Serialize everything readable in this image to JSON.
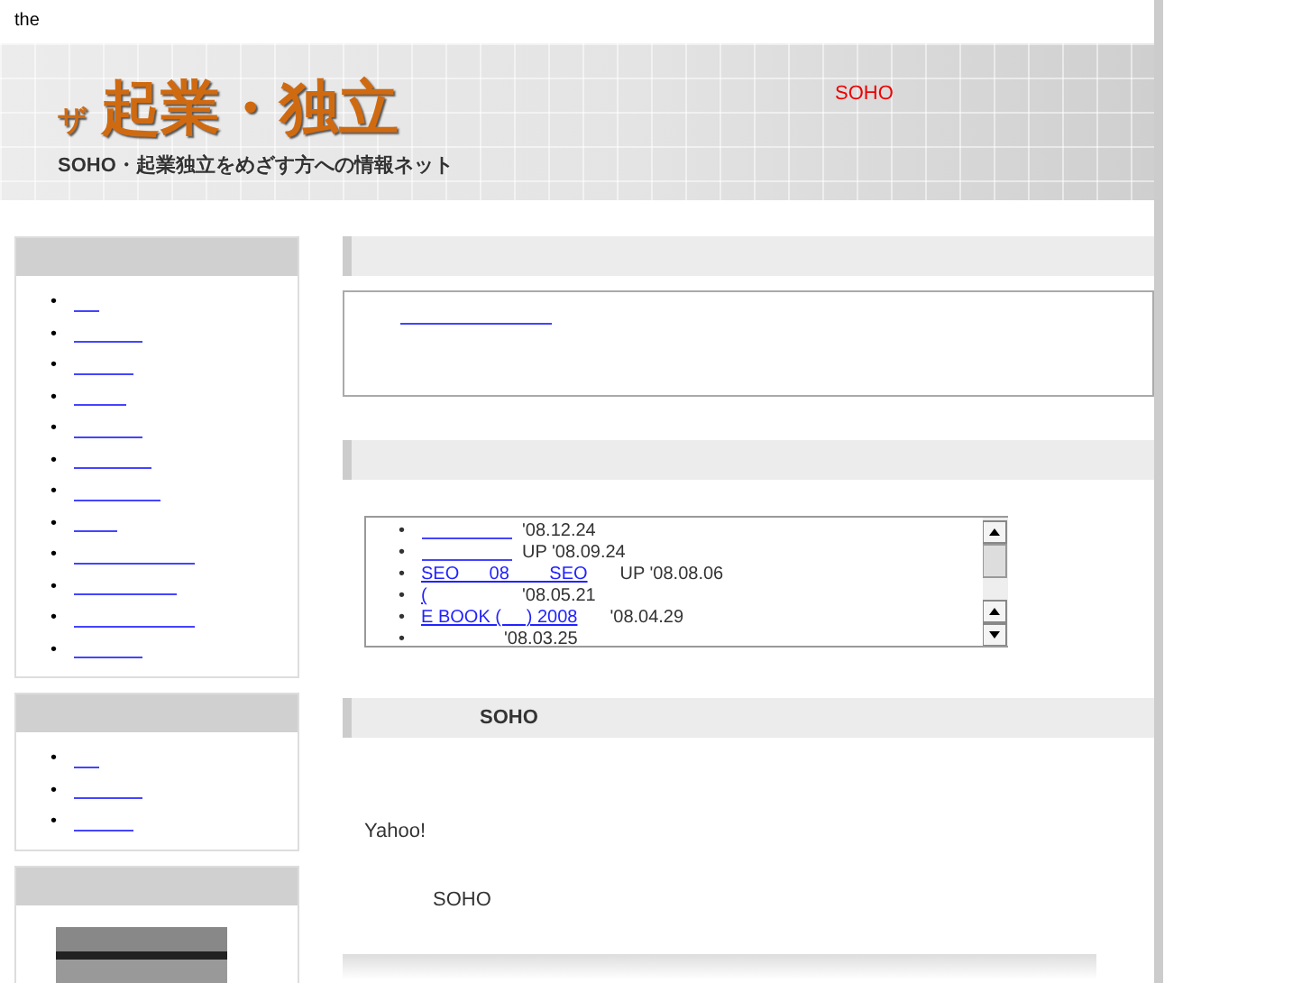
{
  "top_text": "the",
  "banner": {
    "logo_mark": "ザ",
    "logo_title": "起業・独立",
    "logo_tagline": "SOHO・起業独立をめざす方への情報ネット",
    "note": "SOHO"
  },
  "sidebar": [
    {
      "kind": "links",
      "links": [
        {
          "kind": "blank",
          "marker": "•"
        },
        {
          "kind": "blank",
          "marker": "•"
        },
        {
          "kind": "blank",
          "marker": "•"
        },
        {
          "kind": "blank",
          "marker": "•"
        },
        {
          "kind": "blank",
          "marker": "•"
        },
        {
          "kind": "blank",
          "marker": "•"
        },
        {
          "kind": "blank",
          "marker": "•"
        },
        {
          "kind": "blank",
          "marker": "•"
        },
        {
          "kind": "blank",
          "marker": "•"
        },
        {
          "kind": "blank",
          "marker": "•"
        },
        {
          "kind": "blank",
          "marker": "•"
        },
        {
          "kind": "blank",
          "marker": "•"
        }
      ]
    },
    {
      "kind": "links",
      "links": [
        {
          "kind": "blank",
          "marker": "•"
        },
        {
          "kind": "blank",
          "marker": "•"
        },
        {
          "kind": "blank",
          "marker": "•"
        }
      ]
    },
    {
      "kind": "photo"
    }
  ],
  "main": {
    "intro_box": {
      "links": [
        {
          "kind": "blank"
        }
      ]
    },
    "news": [
      {
        "kind": "blank_link",
        "marker": "•",
        "date": "'08.12.24"
      },
      {
        "kind": "blank_link",
        "marker": "•",
        "date": "UP '08.09.24"
      },
      {
        "kind": "link",
        "marker": "•",
        "link": "SEO      08        SEO",
        "date": "UP '08.08.06"
      },
      {
        "kind": "link",
        "marker": "•",
        "link": "(",
        "date": "'08.05.21"
      },
      {
        "kind": "link",
        "marker": "•",
        "link": "E BOOK (     ) 2008",
        "date": "'08.04.29"
      },
      {
        "kind": "plain",
        "marker": "•",
        "date": "'08.03.25"
      }
    ],
    "soho_heading": "SOHO",
    "paragraphs": [
      "Yahoo!",
      "SOHO"
    ]
  }
}
